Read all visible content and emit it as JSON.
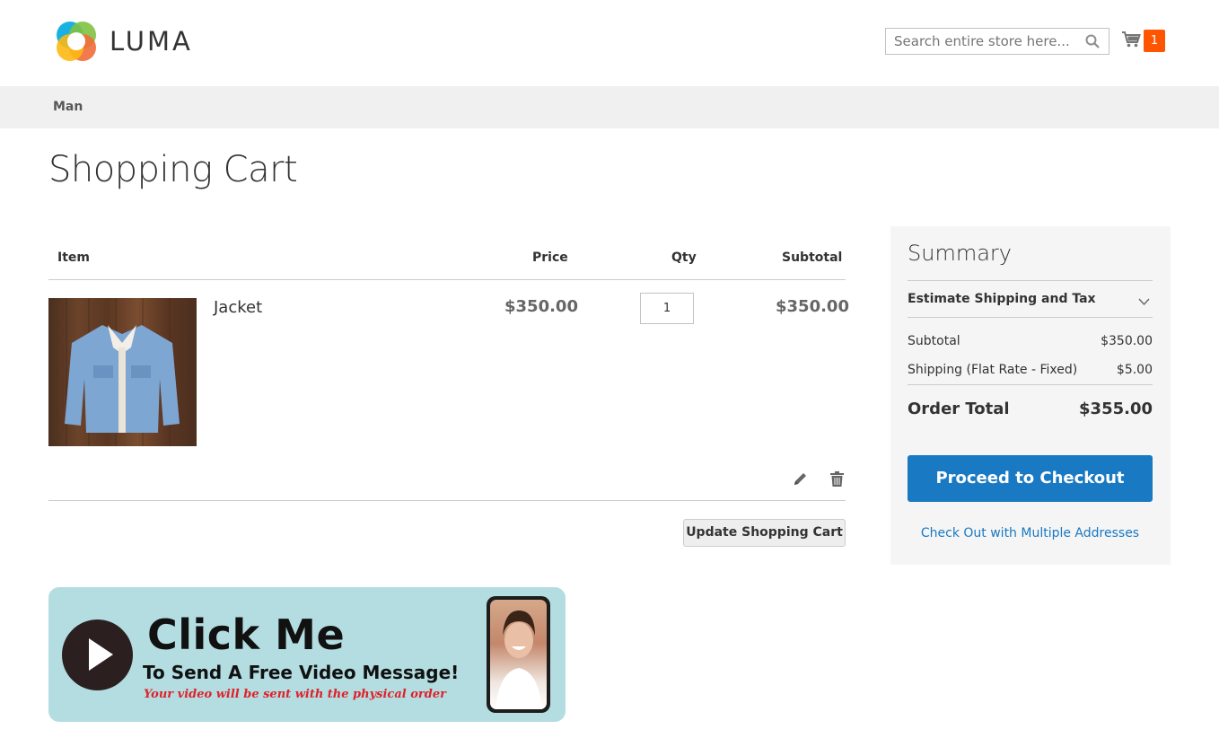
{
  "header": {
    "logo_text": "LUMA",
    "search_placeholder": "Search entire store here...",
    "cart_count": "1"
  },
  "nav": {
    "items": [
      {
        "label": "Man"
      }
    ]
  },
  "page": {
    "title": "Shopping Cart"
  },
  "cart": {
    "columns": [
      "Item",
      "Price",
      "Qty",
      "Subtotal"
    ],
    "items": [
      {
        "name": "Jacket",
        "price": "$350.00",
        "qty": "1",
        "subtotal": "$350.00"
      }
    ],
    "update_label": "Update Shopping Cart"
  },
  "banner": {
    "title": "Click Me",
    "subtitle": "To Send A Free Video Message!",
    "note": "Your video will be sent with the physical order"
  },
  "summary": {
    "title": "Summary",
    "estimate_label": "Estimate Shipping and Tax",
    "rows": [
      {
        "label": "Subtotal",
        "value": "$350.00"
      },
      {
        "label": "Shipping (Flat Rate - Fixed)",
        "value": "$5.00"
      }
    ],
    "total_label": "Order Total",
    "total_value": "$355.00",
    "checkout_label": "Proceed to Checkout",
    "multi_label": "Check Out with Multiple Addresses"
  },
  "colors": {
    "accent": "#1979c3",
    "cart_badge": "#ff5501",
    "nav_bg": "#f0f0f0",
    "summary_bg": "#f5f5f5"
  },
  "icons": [
    "luma-logo-icon",
    "search-icon",
    "cart-icon",
    "edit-icon",
    "trash-icon",
    "chevron-down-icon",
    "play-icon"
  ]
}
